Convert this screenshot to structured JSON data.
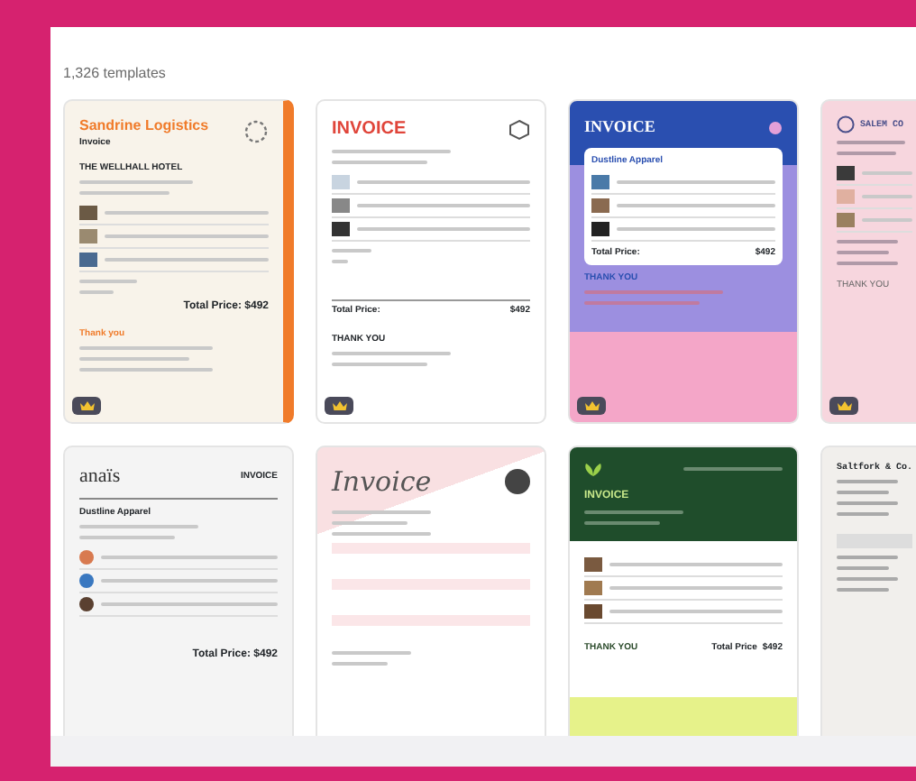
{
  "count_label": "1,326 templates",
  "templates": [
    {
      "kind": "sandrine",
      "premium": true,
      "title": "Sandrine Logistics",
      "subtitle": "Invoice",
      "client": "THE WELLHALL HOTEL",
      "total": "Total Price: $492",
      "footer": "Thank you"
    },
    {
      "kind": "salem",
      "premium": true,
      "title": "INVOICE",
      "total_label": "Total Price:",
      "total": "$492",
      "footer": "THANK YOU"
    },
    {
      "kind": "dustline",
      "premium": true,
      "title": "INVOICE",
      "client": "Dustline Apparel",
      "total_label": "Total Price:",
      "total": "$492",
      "footer": "THANK YOU"
    },
    {
      "kind": "salem_pink",
      "premium": true,
      "title": "SALEM CO",
      "footer": "THANK YOU"
    },
    {
      "kind": "anais",
      "premium": false,
      "brand": "anaïs",
      "title": "INVOICE",
      "client": "Dustline Apparel",
      "total": "Total Price: $492"
    },
    {
      "kind": "script",
      "premium": false,
      "title": "Invoice"
    },
    {
      "kind": "green",
      "premium": false,
      "title": "INVOICE",
      "footer": "THANK YOU",
      "total_label": "Total Price",
      "total": "$492"
    },
    {
      "kind": "saltfork",
      "premium": false,
      "title": "Saltfork & Co."
    }
  ]
}
